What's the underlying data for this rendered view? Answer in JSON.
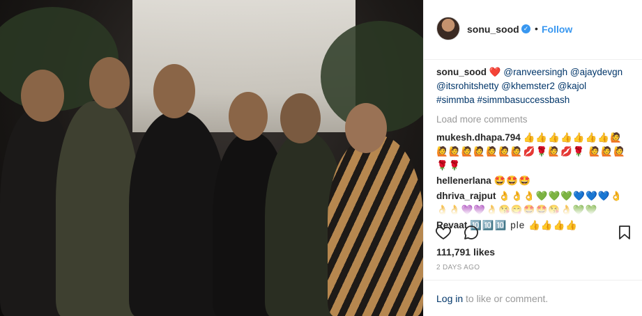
{
  "post": {
    "author": "sonu_sood",
    "follow_label": "Follow",
    "separator": "•",
    "verified_icon": "verified-badge-icon"
  },
  "caption": {
    "user": "sonu_sood",
    "heart": "❤️",
    "line1": "@ranveersingh @ajaydevgn",
    "line2": "@itsrohitshetty @khemster2 @kajol",
    "line3": "#simmba #simmbasuccessbash"
  },
  "load_more_label": "Load more comments",
  "comments": [
    {
      "user": "mukesh.dhapa.794",
      "text": "👍👍👍👍👍👍👍🙋 🙋🙋🙋🙋🙋🙋🙋💋🌹🙋💋🌹 🙋🙋🙋🌹🌹"
    },
    {
      "user": "hellenerlana",
      "text": "🤩🤩🤩"
    },
    {
      "user": "dhriva_rajput",
      "text": "👌👌👌💚💚💚💙💙💙👌 👌👌💜💜👌😘😋🤩🤩😘👌💚💚"
    },
    {
      "user": "Revaat",
      "text": "🔟🔟🔟 ple 👍👍👍👍"
    }
  ],
  "likes": "111,791 likes",
  "time": "2 DAYS AGO",
  "footer": {
    "login_link": "Log in",
    "rest": " to like or comment."
  },
  "colors": {
    "link_blue": "#3897f0",
    "mention": "#003569",
    "muted": "#999999"
  }
}
